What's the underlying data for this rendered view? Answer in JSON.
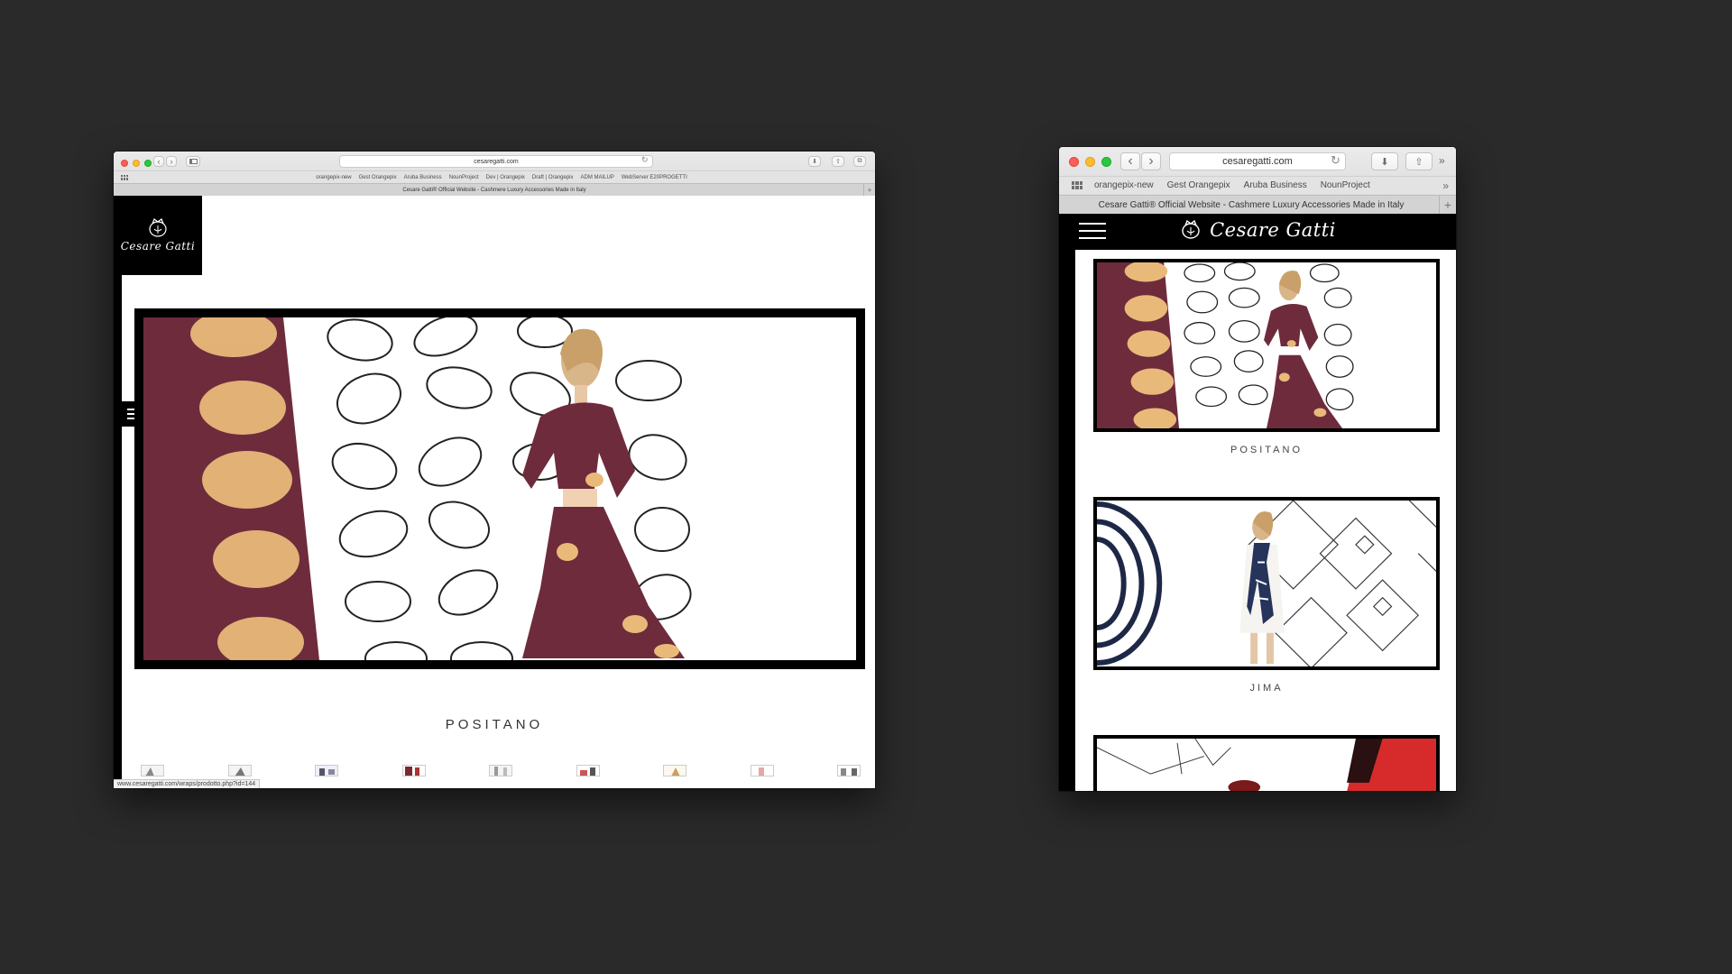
{
  "desktop": {
    "url": "cesaregatti.com",
    "bookmarks": [
      "orangepix-new",
      "Gest Orangepix",
      "Aruba Business",
      "NounProject",
      "Dev | Orangepix",
      "Draft | Orangepix",
      "ADM MAILUP",
      "WebServer E20PROGETTI"
    ],
    "tab_title": "Cesare Gatti® Official Website - Cashmere Luxury Accessories Made in Italy",
    "logo_text": "Cesare Gatti",
    "hero_caption": "POSITANO",
    "status_url": "www.cesaregatti.com/wraps/prodotto.php?id=144"
  },
  "mobile": {
    "url": "cesaregatti.com",
    "bookmarks": [
      "orangepix-new",
      "Gest Orangepix",
      "Aruba Business",
      "NounProject"
    ],
    "tab_title": "Cesare Gatti® Official Website - Cashmere Luxury Accessories Made in Italy",
    "brand": "Cesare Gatti",
    "products": [
      {
        "caption": "POSITANO"
      },
      {
        "caption": "JIMA"
      }
    ]
  },
  "colors": {
    "background": "#2a2a2a",
    "garment": "#6e2b3c",
    "spot": "#e9b97a"
  },
  "icons": [
    "grid-icon",
    "chevron-left-icon",
    "chevron-right-icon",
    "sidebar-icon",
    "reload-icon",
    "download-icon",
    "share-icon",
    "tabs-icon",
    "overflow-icon",
    "plus-icon",
    "hamburger-icon",
    "crest-icon"
  ]
}
